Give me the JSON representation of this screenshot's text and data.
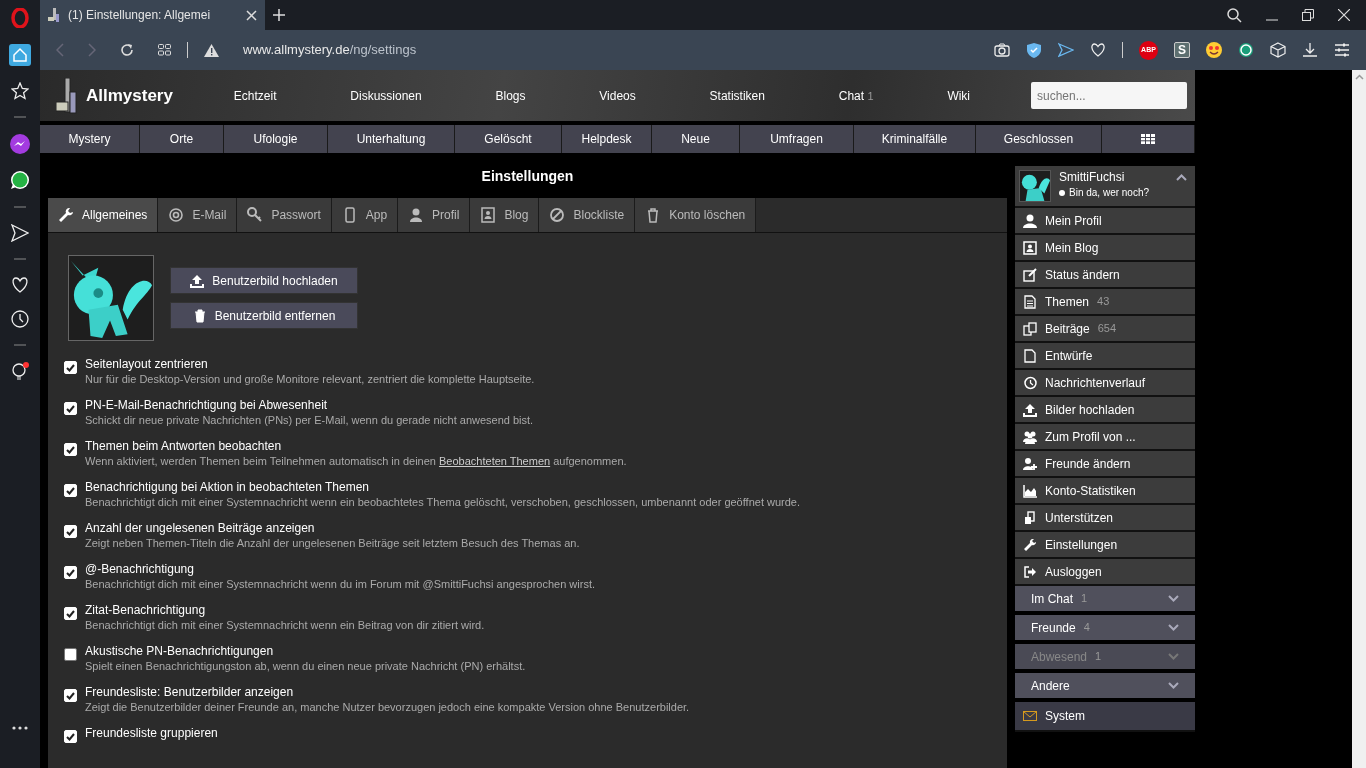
{
  "browser": {
    "tab_title": "(1) Einstellungen: Allgemei",
    "url_host": "www.allmystery.de",
    "url_path": "/ng/settings",
    "extensions": [
      {
        "kind": "abp",
        "label": "ABP"
      },
      {
        "kind": "s",
        "label": "S"
      }
    ]
  },
  "site": {
    "logo": "Allmystery",
    "nav": [
      {
        "label": "Echtzeit"
      },
      {
        "label": "Diskussionen"
      },
      {
        "label": "Blogs"
      },
      {
        "label": "Videos"
      },
      {
        "label": "Statistiken"
      },
      {
        "label": "Chat",
        "count": "1"
      },
      {
        "label": "Wiki"
      }
    ],
    "search": {
      "placeholder": "suchen..."
    },
    "categories": [
      "Mystery",
      "Orte",
      "Ufologie",
      "Unterhaltung",
      "Gelöscht",
      "Helpdesk",
      "Neue",
      "Umfragen",
      "Kriminalfälle",
      "Geschlossen"
    ]
  },
  "page_title": "Einstellungen",
  "tabs": [
    {
      "label": "Allgemeines",
      "selected": true
    },
    {
      "label": "E-Mail",
      "selected": false
    },
    {
      "label": "Passwort",
      "selected": false
    },
    {
      "label": "App",
      "selected": false
    },
    {
      "label": "Profil",
      "selected": false
    },
    {
      "label": "Blog",
      "selected": false
    },
    {
      "label": "Blockliste",
      "selected": false
    },
    {
      "label": "Konto löschen",
      "selected": false
    }
  ],
  "avatar_buttons": [
    "Benutzerbild hochladen",
    "Benutzerbild entfernen"
  ],
  "settings": [
    {
      "label": "Seitenlayout zentrieren",
      "checked": true,
      "description": [
        {
          "text": "Nur für die Desktop-Version und große Monitore relevant, zentriert die komplette Hauptseite."
        }
      ]
    },
    {
      "label": "PN-E-Mail-Benachrichtigung bei Abwesenheit",
      "checked": true,
      "description": [
        {
          "text": "Schickt dir neue private Nachrichten (PNs) per E-Mail, wenn du gerade nicht anwesend bist."
        }
      ]
    },
    {
      "label": "Themen beim Antworten beobachten",
      "checked": true,
      "description": [
        {
          "text": "Wenn aktiviert, werden Themen beim Teilnehmen automatisch in deinen "
        },
        {
          "text": "Beobachteten Themen",
          "kind": "link"
        },
        {
          "text": " aufgenommen."
        }
      ]
    },
    {
      "label": "Benachrichtigung bei Aktion in beobachteten Themen",
      "checked": true,
      "description": [
        {
          "text": "Benachrichtigt dich mit einer Systemnachricht wenn ein beobachtetes Thema gelöscht, verschoben, geschlossen, umbenannt oder geöffnet wurde."
        }
      ]
    },
    {
      "label": "Anzahl der ungelesenen Beiträge anzeigen",
      "checked": true,
      "description": [
        {
          "text": "Zeigt neben Themen-Titeln die Anzahl der ungelesenen Beiträge seit letztem Besuch des Themas an."
        }
      ]
    },
    {
      "label": "@-Benachrichtigung",
      "checked": true,
      "description": [
        {
          "text": "Benachrichtigt dich mit einer Systemnachricht wenn du im Forum mit @SmittiFuchsi angesprochen wirst."
        }
      ]
    },
    {
      "label": "Zitat-Benachrichtigung",
      "checked": true,
      "description": [
        {
          "text": "Benachrichtigt dich mit einer Systemnachricht wenn ein Beitrag von dir zitiert wird."
        }
      ]
    },
    {
      "label": "Akustische PN-Benachrichtigungen",
      "checked": false,
      "description": [
        {
          "text": "Spielt einen Benachrichtigungston ab, wenn du einen neue private Nachricht (PN) erhältst."
        }
      ]
    },
    {
      "label": "Freundesliste: Benutzerbilder anzeigen",
      "checked": true,
      "description": [
        {
          "text": "Zeigt die Benutzerbilder deiner Freunde an, manche Nutzer bevorzugen jedoch eine kompakte Version ohne Benutzerbilder."
        }
      ]
    },
    {
      "label": "Freundesliste gruppieren",
      "checked": true
    }
  ],
  "user": {
    "name": "SmittiFuchsi",
    "status": "Bin da, wer noch?"
  },
  "user_menu": [
    {
      "label": "Mein Profil"
    },
    {
      "label": "Mein Blog"
    },
    {
      "label": "Status ändern"
    },
    {
      "label": "Themen",
      "count": "43"
    },
    {
      "label": "Beiträge",
      "count": "654"
    },
    {
      "label": "Entwürfe"
    },
    {
      "label": "Nachrichtenverlauf"
    },
    {
      "label": "Bilder hochladen"
    },
    {
      "label": "Zum Profil von ..."
    },
    {
      "label": "Freunde ändern"
    },
    {
      "label": "Konto-Statistiken"
    },
    {
      "label": "Unterstützen"
    },
    {
      "label": "Einstellungen"
    },
    {
      "label": "Ausloggen"
    }
  ],
  "groups": [
    {
      "label": "Im Chat",
      "count": "1",
      "disabled": false
    },
    {
      "label": "Freunde",
      "count": "4",
      "disabled": false
    },
    {
      "label": "Abwesend",
      "count": "1",
      "disabled": true
    },
    {
      "label": "Andere",
      "disabled": false
    }
  ],
  "other_items": [
    {
      "label": "System"
    }
  ]
}
